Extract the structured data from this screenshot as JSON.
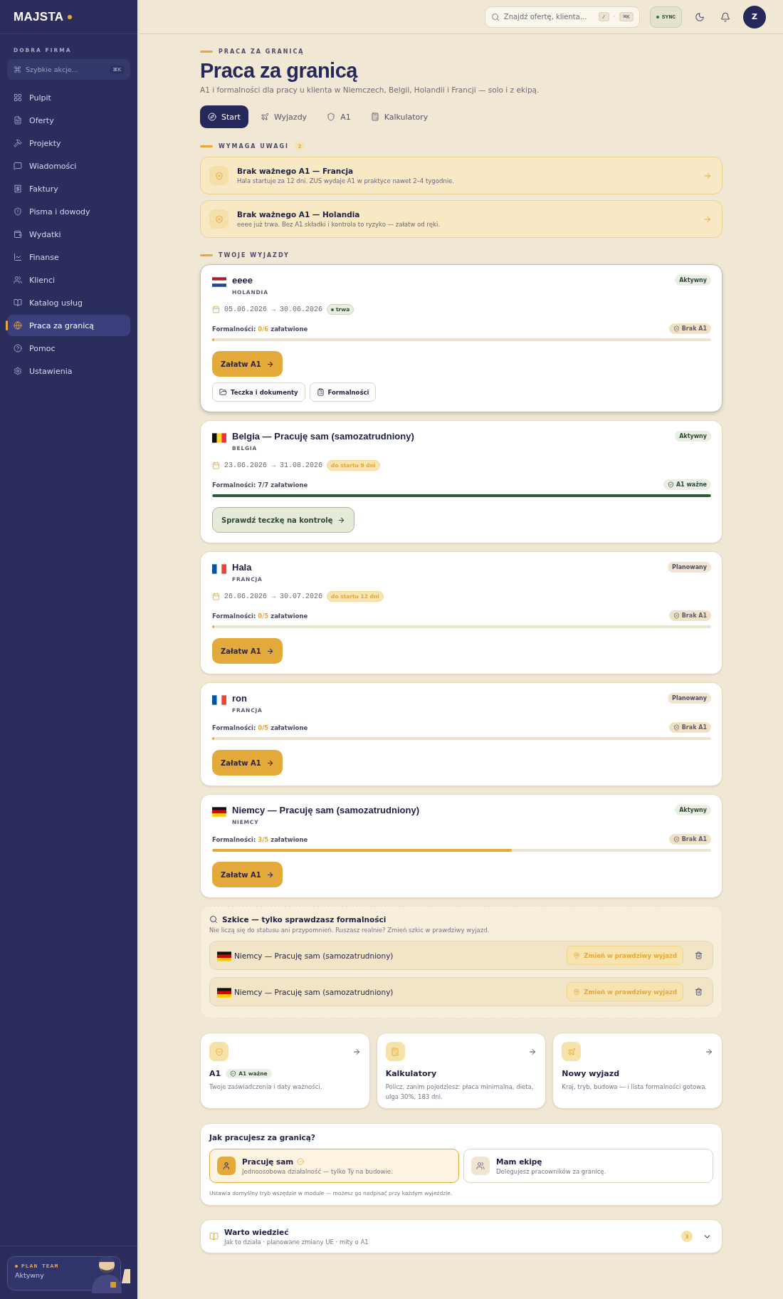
{
  "sidebar": {
    "brand": "MAJSTA",
    "org": "DOBRA FIRMA",
    "quick_search": {
      "placeholder": "Szybkie akcje...",
      "shortcut": "⌘K"
    },
    "items": [
      {
        "label": "Pulpit",
        "selected": false
      },
      {
        "label": "Oferty",
        "selected": false
      },
      {
        "label": "Projekty",
        "selected": false
      },
      {
        "label": "Wiadomości",
        "selected": false
      },
      {
        "label": "Faktury",
        "selected": false
      },
      {
        "label": "Pisma i dowody",
        "selected": false
      },
      {
        "label": "Wydatki",
        "selected": false
      },
      {
        "label": "Finanse",
        "selected": false
      },
      {
        "label": "Klienci",
        "selected": false
      },
      {
        "label": "Katalog usług",
        "selected": false
      },
      {
        "label": "Praca za granicą",
        "selected": true
      },
      {
        "label": "Pomoc",
        "selected": false
      },
      {
        "label": "Ustawienia",
        "selected": false
      }
    ],
    "plan": {
      "label": "PLAN TEAM",
      "status": "Aktywny"
    }
  },
  "header": {
    "search": {
      "placeholder": "Znajdź ofertę, klienta...",
      "keys": [
        "/",
        "⌘K"
      ],
      "separator": "·"
    },
    "sync": "SYNC",
    "avatar": "Z"
  },
  "page": {
    "eyebrow": "PRACA ZA GRANICĄ",
    "title": "Praca za granicą",
    "subtitle": "A1 i formalności dla pracy u klienta w Niemczech, Belgii, Holandii i Francji — solo i z ekipą."
  },
  "tabs": [
    {
      "label": "Start",
      "selected": true
    },
    {
      "label": "Wyjazdy",
      "selected": false
    },
    {
      "label": "A1",
      "selected": false
    },
    {
      "label": "Kalkulatory",
      "selected": false
    }
  ],
  "attention": {
    "label": "WYMAGA UWAGI",
    "count": "2",
    "alerts": [
      {
        "title": "Brak ważnego A1 — Francja",
        "text": "Hala startuje za 12 dni. ZUS wydaje A1 w praktyce nawet 2–4 tygodnie."
      },
      {
        "title": "Brak ważnego A1 — Holandia",
        "text": "eeee już trwa. Bez A1 składki i kontrola to ryzyko — załatw od ręki."
      }
    ]
  },
  "trips": {
    "label": "TWOJE WYJAZDY",
    "items": [
      {
        "title": "eeee",
        "country": "HOLANDIA",
        "kind": "nl",
        "highlighted": true,
        "status": {
          "text": "Aktywny",
          "kind": "active"
        },
        "dates": "05.06.2026 → 30.06.2026",
        "date_badge": {
          "text": "trwa",
          "kind": "live"
        },
        "progress": {
          "prefix": "Formalności:",
          "count": "0/6",
          "suffix": "załatwione",
          "level": 0
        },
        "a1": {
          "text": "Brak A1",
          "valid": false
        },
        "action": {
          "text": "Załatw A1",
          "kind": "fix"
        },
        "links": [
          "Teczka i dokumenty",
          "Formalności"
        ]
      },
      {
        "title": "Belgia — Pracuję sam (samozatrudniony)",
        "country": "BELGIA",
        "kind": "be",
        "highlighted": false,
        "status": {
          "text": "Aktywny",
          "kind": "active"
        },
        "dates": "23.06.2026 → 31.08.2026",
        "date_badge": {
          "text": "do startu 9 dni",
          "kind": "soon"
        },
        "progress": {
          "prefix": "Formalności:",
          "count": "7/7",
          "suffix": "załatwione",
          "level": 1
        },
        "a1": {
          "text": "A1 ważne",
          "valid": true
        },
        "action": {
          "text": "Sprawdź teczkę na kontrolę",
          "kind": "check"
        }
      },
      {
        "title": "Hala",
        "country": "FRANCJA",
        "kind": "fr",
        "highlighted": false,
        "status": {
          "text": "Planowany",
          "kind": "planned"
        },
        "dates": "26.06.2026 → 30.07.2026",
        "date_badge": {
          "text": "do startu 12 dni",
          "kind": "soon"
        },
        "progress": {
          "prefix": "Formalności:",
          "count": "0/5",
          "suffix": "załatwione",
          "level": 0
        },
        "a1": {
          "text": "Brak A1",
          "valid": false
        },
        "action": {
          "text": "Załatw A1",
          "kind": "fix"
        }
      },
      {
        "title": "ron",
        "country": "FRANCJA",
        "kind": "fr",
        "highlighted": false,
        "status": {
          "text": "Planowany",
          "kind": "planned"
        },
        "progress": {
          "prefix": "Formalności:",
          "count": "0/5",
          "suffix": "załatwione",
          "level": 0
        },
        "a1": {
          "text": "Brak A1",
          "valid": false
        },
        "action": {
          "text": "Załatw A1",
          "kind": "fix"
        }
      },
      {
        "title": "Niemcy — Pracuję sam (samozatrudniony)",
        "country": "NIEMCY",
        "kind": "de",
        "highlighted": false,
        "status": {
          "text": "Aktywny",
          "kind": "active"
        },
        "progress": {
          "prefix": "Formalności:",
          "count": "3/5",
          "suffix": "załatwione",
          "level": 0.6
        },
        "a1": {
          "text": "Brak A1",
          "valid": false
        },
        "action": {
          "text": "Załatw A1",
          "kind": "fix"
        }
      }
    ]
  },
  "drafts": {
    "title": "Szkice — tylko sprawdzasz formalności",
    "text": "Nie liczą się do statusu ani przypomnień. Ruszasz realnie? Zmień szkic w prawdziwy wyjazd.",
    "items": [
      {
        "kind": "de",
        "title": "Niemcy — Pracuję sam (samozatrudniony)",
        "action": "Zmień w prawdziwy wyjazd"
      },
      {
        "kind": "de",
        "title": "Niemcy — Pracuję sam (samozatrudniony)",
        "action": "Zmień w prawdziwy wyjazd"
      }
    ]
  },
  "tiles": [
    {
      "title": "A1",
      "badge": "A1 ważne",
      "text": "Twoje zaświadczenia i daty ważności."
    },
    {
      "title": "Kalkulatory",
      "text": "Policz, zanim pojedziesz: płaca minimalna, dieta, ulga 30%, 183 dni."
    },
    {
      "title": "Nowy wyjazd",
      "text": "Kraj, tryb, budowa — i lista formalności gotowa."
    }
  ],
  "mode": {
    "question": "Jak pracujesz za granicą?",
    "options": [
      {
        "title": "Pracuję sam",
        "text": "Jednoosobowa działalność — tylko Ty na budowie.",
        "selected": true
      },
      {
        "title": "Mam ekipę",
        "text": "Delegujesz pracowników za granicę.",
        "selected": false
      }
    ],
    "note": "Ustawia domyślny tryb wszędzie w module — możesz go nadpisać przy każdym wyjeździe."
  },
  "knowledge": {
    "title": "Warto wiedzieć",
    "text": "Jak to działa · planowane zmiany UE · mity o A1",
    "count": "3",
    "expanded": false
  }
}
